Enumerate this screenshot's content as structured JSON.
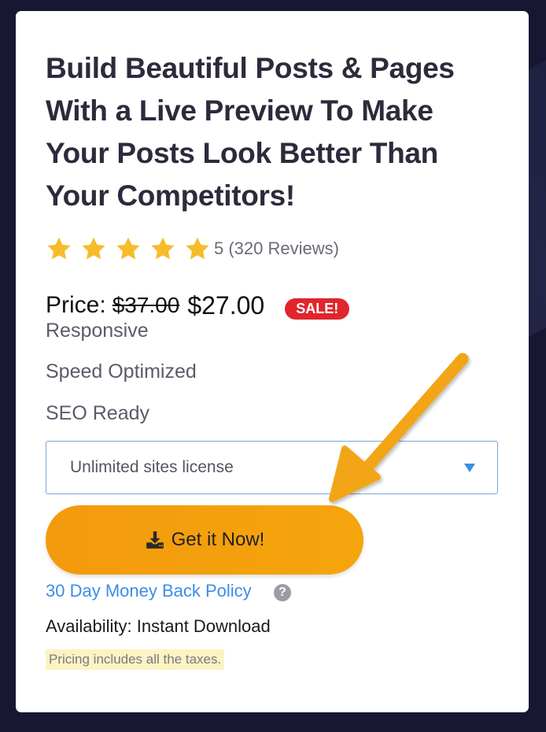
{
  "product": {
    "title": "Build Beautiful Posts & Pages With a Live Preview To Make Your Posts Look Better Than Your Competitors!",
    "rating": {
      "stars": 5,
      "text": "5 (320 Reviews)",
      "star_color": "#f7bc2b"
    },
    "price": {
      "label": "Price:",
      "old": "$37.00",
      "new": "$27.00",
      "badge": "SALE!",
      "badge_color": "#e0252d"
    },
    "features": [
      "Responsive",
      "Speed Optimized",
      "SEO Ready"
    ],
    "license_select": {
      "value": "Unlimited sites license",
      "icon": "caret-down-icon"
    },
    "cta": {
      "label": "Get it Now!",
      "icon": "download-icon",
      "color": "#f5a00d"
    },
    "policy": {
      "label": "30 Day Money Back Policy",
      "icon": "help-icon",
      "help_symbol": "?"
    },
    "availability": "Availability: Instant Download",
    "taxes_note": "Pricing includes all the taxes."
  },
  "colors": {
    "link": "#3a8ee8",
    "arrow": "#f2a516",
    "background": "#171733"
  }
}
